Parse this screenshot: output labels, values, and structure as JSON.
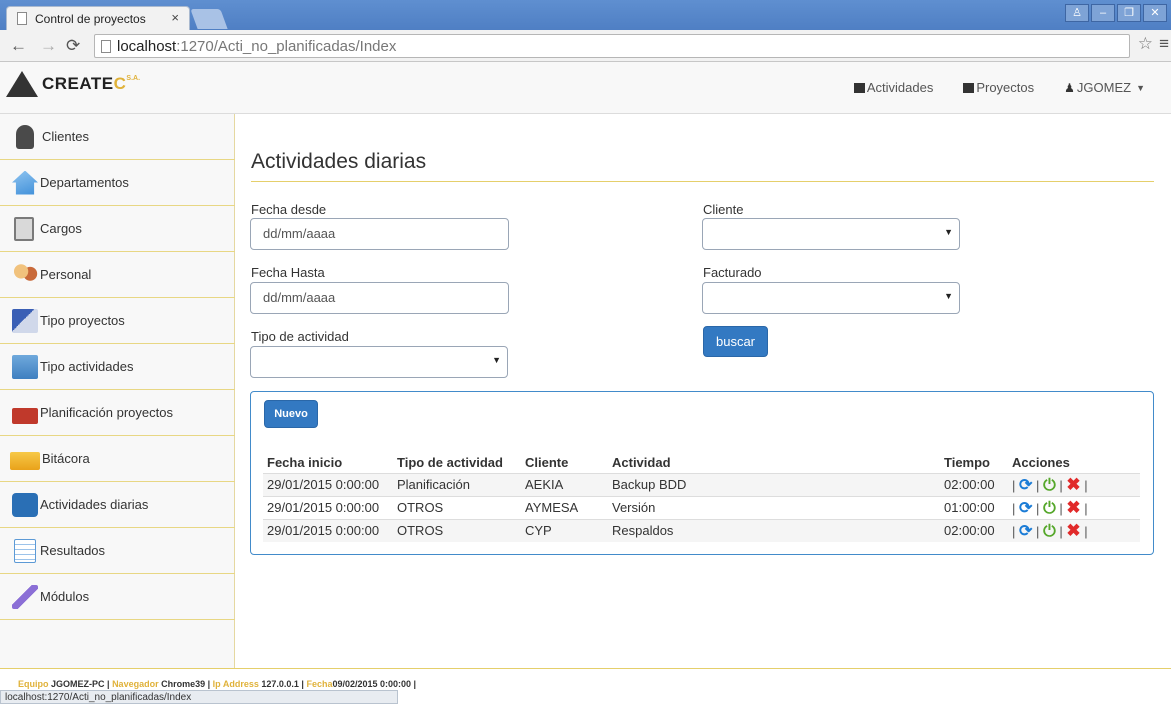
{
  "browser": {
    "tab_title": "Control de proyectos",
    "tab_close": "×",
    "url_host": "localhost",
    "url_path": ":1270/Acti_no_planificadas/Index"
  },
  "header": {
    "logo_text_a": "CREATE",
    "logo_text_b": "C",
    "logo_suffix": "S.A.",
    "nav": [
      {
        "label": "Actividades",
        "icon": "calendar-icon"
      },
      {
        "label": "Proyectos",
        "icon": "folder-icon"
      },
      {
        "label": "JGOMEZ",
        "icon": "user-icon"
      }
    ]
  },
  "sidebar": {
    "items": [
      {
        "label": "Clientes",
        "icon": "client-icon",
        "color": "#4a4a4a"
      },
      {
        "label": "Departamentos",
        "icon": "house-icon",
        "color": "#3f8fd9"
      },
      {
        "label": "Cargos",
        "icon": "clipboard-icon",
        "color": "#6aa84f"
      },
      {
        "label": "Personal",
        "icon": "people-icon",
        "color": "#c96a3a"
      },
      {
        "label": "Tipo proyectos",
        "icon": "pen-icon",
        "color": "#3a5fb5"
      },
      {
        "label": "Tipo actividades",
        "icon": "folder-icon",
        "color": "#4a90c8"
      },
      {
        "label": "Planificación proyectos",
        "icon": "toolbox-icon",
        "color": "#c0392b"
      },
      {
        "label": "Bitácora",
        "icon": "folder-icon",
        "color": "#f0b429"
      },
      {
        "label": "Actividades diarias",
        "icon": "people-group-icon",
        "color": "#2a6fb5"
      },
      {
        "label": "Resultados",
        "icon": "spreadsheet-icon",
        "color": "#5c9ad6"
      },
      {
        "label": "Módulos",
        "icon": "pencil-icon",
        "color": "#8b6fd6"
      }
    ]
  },
  "main": {
    "title": "Actividades diarias",
    "form": {
      "fecha_desde_label": "Fecha desde",
      "fecha_desde_value": "dd/mm/aaaa",
      "fecha_hasta_label": "Fecha Hasta",
      "fecha_hasta_value": "dd/mm/aaaa",
      "tipo_actividad_label": "Tipo de actividad",
      "cliente_label": "Cliente",
      "facturado_label": "Facturado",
      "buscar_label": "buscar"
    },
    "nuevo_label": "Nuevo",
    "table": {
      "headers": [
        "Fecha inicio",
        "Tipo de actividad",
        "Cliente",
        "Actividad",
        "Tiempo",
        "Acciones"
      ],
      "rows": [
        [
          "29/01/2015 0:00:00",
          "Planificación",
          "AEKIA",
          "Backup BDD",
          "02:00:00"
        ],
        [
          "29/01/2015 0:00:00",
          "OTROS",
          "AYMESA",
          "Versión",
          "01:00:00"
        ],
        [
          "29/01/2015 0:00:00",
          "OTROS",
          "CYP",
          "Respaldos",
          "02:00:00"
        ]
      ],
      "sep": "|"
    }
  },
  "footer": {
    "equipo_key": "Equipo",
    "equipo_val": "JGOMEZ-PC |",
    "navegador_key": "Navegador",
    "navegador_val": "Chrome39 |",
    "ip_key": "Ip Address",
    "ip_val": "127.0.0.1 |",
    "fecha_key": "Fecha",
    "fecha_val": "09/02/2015 0:00:00 |"
  },
  "status_url": "localhost:1270/Acti_no_planificadas/Index"
}
